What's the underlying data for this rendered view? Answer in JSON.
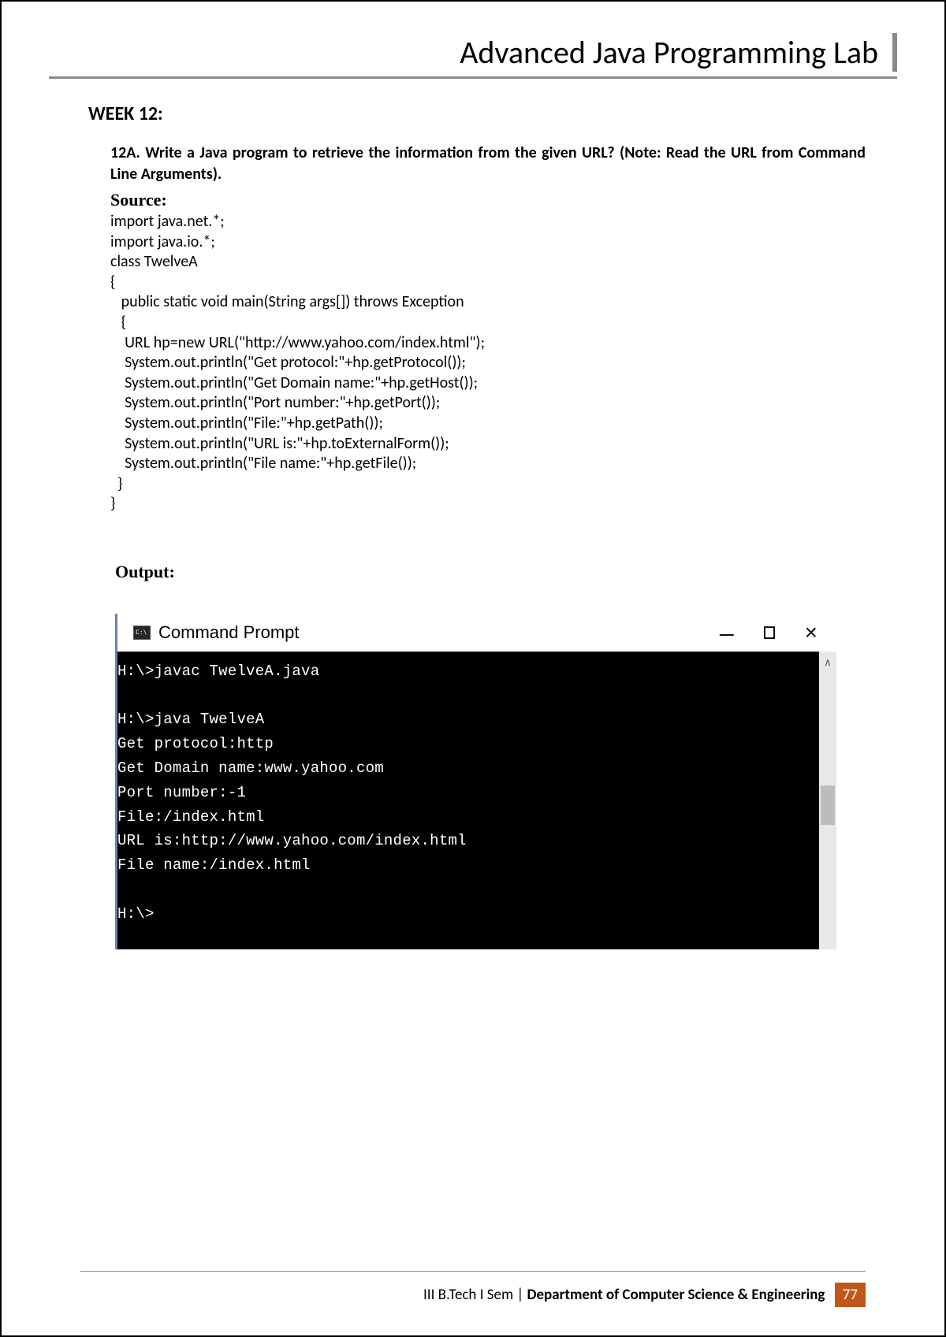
{
  "header": {
    "title": "Advanced Java Programming Lab"
  },
  "week": {
    "heading": "WEEK 12:",
    "question": "12A. Write a Java program to retrieve the information from the given URL? (Note: Read the URL from Command Line Arguments).",
    "source_label": "Source:",
    "code": "import java.net.*;\nimport java.io.*;\nclass TwelveA\n{\n   public static void main(String args[]) throws Exception\n   {\n    URL hp=new URL(\"http://www.yahoo.com/index.html\");\n    System.out.println(\"Get protocol:\"+hp.getProtocol());\n    System.out.println(\"Get Domain name:\"+hp.getHost());\n    System.out.println(\"Port number:\"+hp.getPort());\n    System.out.println(\"File:\"+hp.getPath());\n    System.out.println(\"URL is:\"+hp.toExternalForm());\n    System.out.println(\"File name:\"+hp.getFile());\n  }\n}",
    "output_label": "Output:"
  },
  "cmd": {
    "title": "Command Prompt",
    "body": "H:\\>javac TwelveA.java\n\nH:\\>java TwelveA\nGet protocol:http\nGet Domain name:www.yahoo.com\nPort number:-1\nFile:/index.html\nURL is:http://www.yahoo.com/index.html\nFile name:/index.html\n\nH:\\>"
  },
  "footer": {
    "sem": "III B.Tech I Sem | ",
    "dept": "Department of Computer Science & Engineering",
    "page": "77"
  }
}
